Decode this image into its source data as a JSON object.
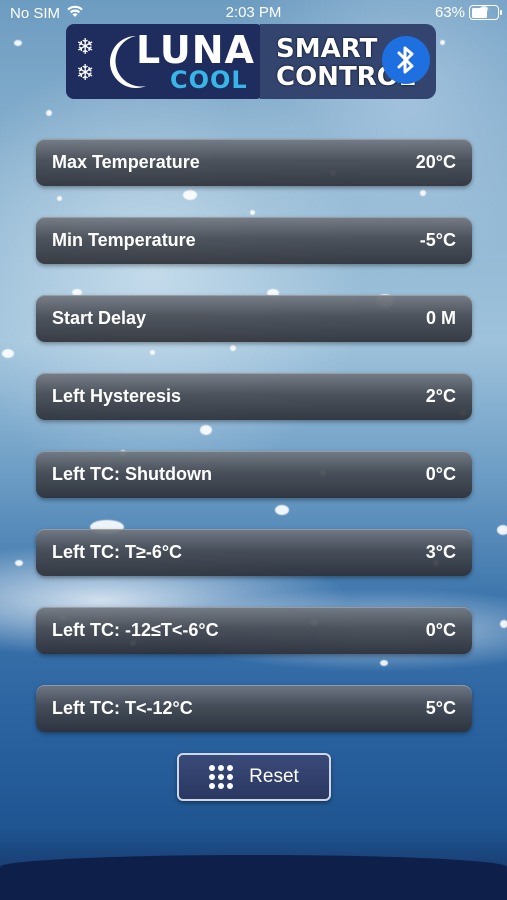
{
  "status_bar": {
    "carrier": "No SIM",
    "time": "2:03 PM",
    "battery": "63%",
    "battery_level": 0.63
  },
  "logo": {
    "brand_top": "LUNA",
    "brand_bottom": "COOL",
    "smart": "SMART",
    "control": "CONTROL",
    "icon": "bluetooth-icon"
  },
  "settings": [
    {
      "label": "Max Temperature",
      "value": "20°C"
    },
    {
      "label": "Min Temperature",
      "value": "-5°C"
    },
    {
      "label": "Start Delay",
      "value": "0 M"
    },
    {
      "label": "Left Hysteresis",
      "value": "2°C"
    },
    {
      "label": "Left TC: Shutdown",
      "value": "0°C"
    },
    {
      "label": "Left TC: T≥-6°C",
      "value": "3°C"
    },
    {
      "label": "Left TC: -12≤T<-6°C",
      "value": "0°C"
    },
    {
      "label": "Left TC: T<-12°C",
      "value": "5°C"
    }
  ],
  "reset": {
    "label": "Reset",
    "icon": "grid-dots-icon"
  },
  "colors": {
    "accent_blue": "#1e6fe0",
    "cool_cyan": "#38b6e8",
    "logo_navy": "#1f2c5e"
  }
}
